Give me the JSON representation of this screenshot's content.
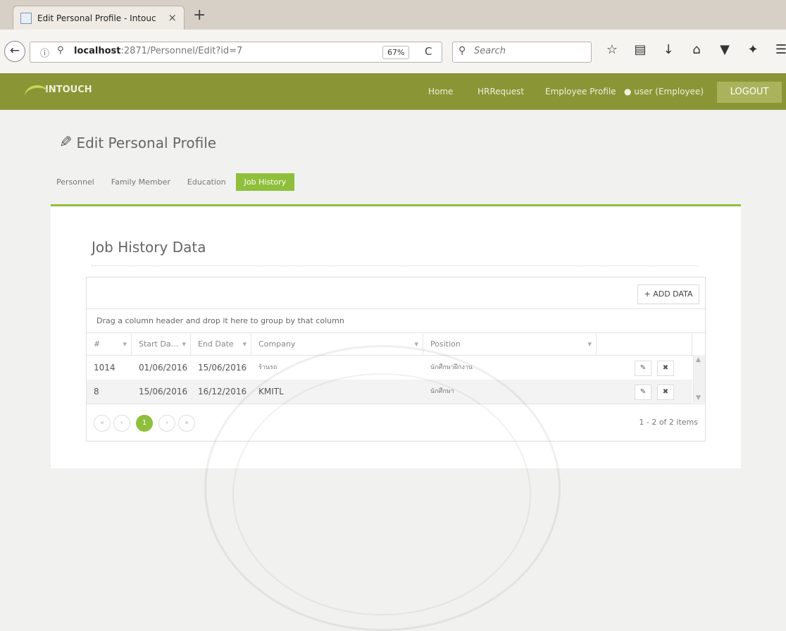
{
  "browser": {
    "tab_title": "Edit Personal Profile - Intouc",
    "tab_close": "×",
    "new_tab": "+",
    "url_host": "localhost",
    "url_path": ":2871/Personnel/Edit?id=7",
    "zoom": "67%",
    "search_placeholder": "Search",
    "icons": [
      "bookmark-star-icon",
      "reading-list-icon",
      "download-icon",
      "home-icon",
      "pocket-icon",
      "extension-icon",
      "menu-icon"
    ]
  },
  "navbar": {
    "logo": "INTOUCH",
    "items": [
      "Home",
      "HRRequest",
      "Employee Profile"
    ],
    "user": "user (Employee)",
    "logout": "LOGOUT",
    "color": "#8a9536"
  },
  "page": {
    "title": "Edit Personal Profile",
    "tabs": [
      "Personnel",
      "Family Member",
      "Education",
      "Job History"
    ],
    "active_tab": "Job History"
  },
  "panel": {
    "title": "Job History Data",
    "add_button": "+ ADD DATA",
    "group_hint": "Drag a column header and drop it here to group by that column",
    "columns": [
      "#",
      "Start Da...",
      "End Date",
      "Company",
      "Position"
    ],
    "rows": [
      {
        "id": "1014",
        "start": "01/06/2016",
        "end": "15/06/2016",
        "company": "ร้านรถ",
        "position": "นักศึกษาฝึกงาน"
      },
      {
        "id": "8",
        "start": "15/06/2016",
        "end": "16/12/2016",
        "company": "KMITL",
        "position": "นักศึกษา"
      }
    ],
    "pager": {
      "first": "«",
      "prev": "‹",
      "current": "1",
      "next": "›",
      "last": "»",
      "info": "1 - 2 of 2 items"
    },
    "accent": "#8fbf3b"
  }
}
